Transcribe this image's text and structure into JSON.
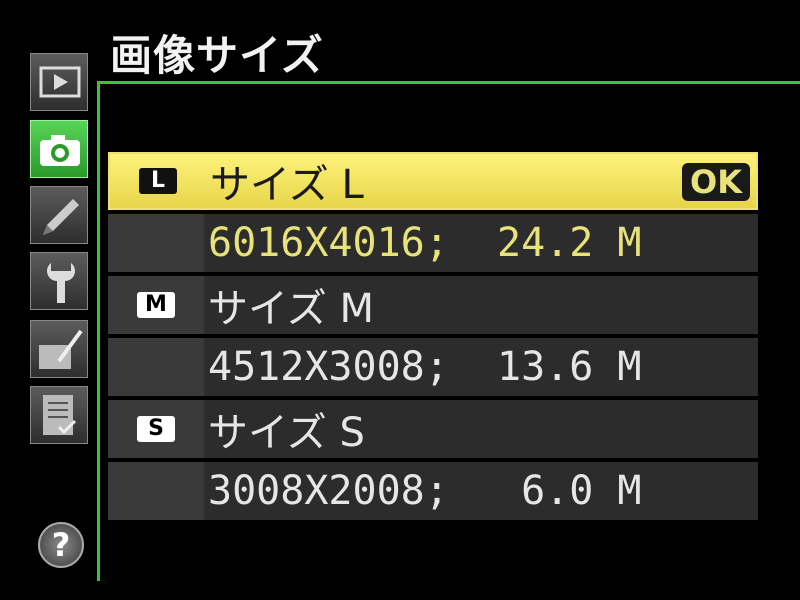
{
  "header": {
    "title": "画像サイズ"
  },
  "tabs": [
    {
      "name": "playback-menu",
      "icon": "play-icon",
      "active": false
    },
    {
      "name": "shooting-menu",
      "icon": "camera-icon",
      "active": true
    },
    {
      "name": "custom-settings-menu",
      "icon": "pencil-icon",
      "active": false
    },
    {
      "name": "setup-menu",
      "icon": "wrench-icon",
      "active": false
    },
    {
      "name": "retouch-menu",
      "icon": "retouch-brush-icon",
      "active": false
    },
    {
      "name": "my-menu",
      "icon": "checklist-icon",
      "active": false
    }
  ],
  "help": {
    "label": "?"
  },
  "options": [
    {
      "icon_label": "L",
      "label": "サイズ L",
      "detail": "6016X4016;  24.2 M",
      "selected": true
    },
    {
      "icon_label": "M",
      "label": "サイズ M",
      "detail": "4512X3008;  13.6 M",
      "selected": false
    },
    {
      "icon_label": "S",
      "label": "サイズ S",
      "detail": "3008X2008;   6.0 M",
      "selected": false
    }
  ],
  "ok_label": "OK",
  "colors": {
    "accent_green": "#3cc23c",
    "highlight_yellow": "#f0e070"
  }
}
